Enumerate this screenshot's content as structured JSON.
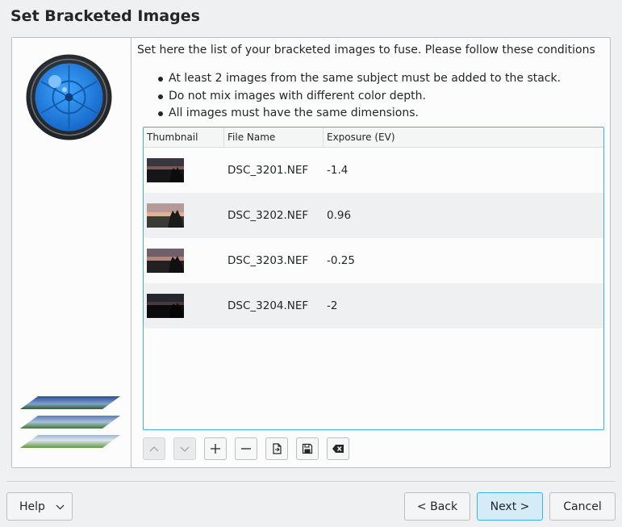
{
  "page": {
    "title": "Set Bracketed Images"
  },
  "intro": "Set here the list of your bracketed images to fuse. Please follow these conditions",
  "conditions": [
    "At least 2 images from the same subject must be added to the stack.",
    "Do not mix images with different color depth.",
    "All images must have the same dimensions."
  ],
  "table": {
    "headers": [
      "Thumbnail",
      "File Name",
      "Exposure (EV)"
    ],
    "rows": [
      {
        "file": "DSC_3201.NEF",
        "exposure": "-1.4"
      },
      {
        "file": "DSC_3202.NEF",
        "exposure": "0.96"
      },
      {
        "file": "DSC_3203.NEF",
        "exposure": "-0.25"
      },
      {
        "file": "DSC_3204.NEF",
        "exposure": "-2"
      }
    ]
  },
  "toolbar": {
    "icons": [
      "arrow-up-icon",
      "arrow-down-icon",
      "plus-icon",
      "minus-icon",
      "load-file-icon",
      "save-icon",
      "clear-icon"
    ]
  },
  "buttons": {
    "help": "Help",
    "back": "< Back",
    "next": "Next >",
    "cancel": "Cancel"
  },
  "colors": {
    "accent": "#3daee9",
    "lens_blue": "#2a8ef0"
  }
}
